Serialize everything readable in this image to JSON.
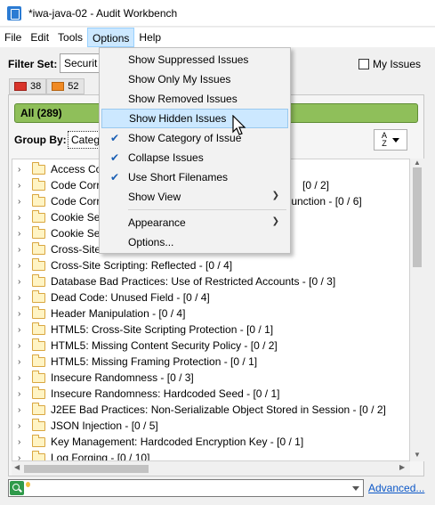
{
  "window": {
    "title": "*iwa-java-02 - Audit Workbench"
  },
  "menubar": {
    "items": [
      "File",
      "Edit",
      "Tools",
      "Options",
      "Help"
    ],
    "active": "Options"
  },
  "filter": {
    "label": "Filter Set:",
    "value": "Securit",
    "my_issues_label": "My Issues"
  },
  "severity_tabs": [
    {
      "count": "38",
      "color": "#d9342b"
    },
    {
      "count": "52",
      "color": "#f08a24"
    }
  ],
  "all_bar": {
    "label": "All (289)"
  },
  "group_by": {
    "label": "Group By:",
    "value": "Categ"
  },
  "sort_icon": {
    "top": "A",
    "bottom": "Z"
  },
  "tree": {
    "rows": [
      "Access Con",
      "Code Corre",
      "Code Corre",
      "Cookie Secu",
      "Cookie Secu",
      "Cross-Site F",
      "Cross-Site Scripting: Reflected - [0 / 4]",
      "Database Bad Practices: Use of Restricted Accounts - [0 / 3]",
      "Dead Code: Unused Field - [0 / 4]",
      "Header Manipulation - [0 / 4]",
      "HTML5: Cross-Site Scripting Protection - [0 / 1]",
      "HTML5: Missing Content Security Policy - [0 / 2]",
      "HTML5: Missing Framing Protection - [0 / 1]",
      "Insecure Randomness - [0 / 3]",
      "Insecure Randomness: Hardcoded Seed - [0 / 1]",
      "J2EE Bad Practices: Non-Serializable Object Stored in Session - [0 / 2]",
      "JSON Injection - [0 / 5]",
      "Key Management: Hardcoded Encryption Key - [0 / 1]",
      "Log Forging - [0 / 10]"
    ],
    "partial_right": [
      {
        "row": 1,
        "text": "[0 / 2]"
      },
      {
        "row": 2,
        "text": "Function - [0 / 6]"
      }
    ]
  },
  "options_menu": {
    "items": [
      {
        "label": "Show Suppressed Issues",
        "checked": false,
        "submenu": false
      },
      {
        "label": "Show Only My Issues",
        "checked": false,
        "submenu": false
      },
      {
        "label": "Show Removed Issues",
        "checked": false,
        "submenu": false
      },
      {
        "label": "Show Hidden Issues",
        "checked": false,
        "submenu": false,
        "hover": true
      },
      {
        "label": "Show Category of Issue",
        "checked": true,
        "submenu": false
      },
      {
        "label": "Collapse Issues",
        "checked": true,
        "submenu": false
      },
      {
        "label": "Use Short Filenames",
        "checked": true,
        "submenu": false
      },
      {
        "label": "Show View",
        "checked": false,
        "submenu": true
      },
      {
        "label": "Appearance",
        "checked": false,
        "submenu": true
      },
      {
        "label": "Options...",
        "checked": false,
        "submenu": false
      }
    ]
  },
  "search": {
    "value": "",
    "advanced_label": "Advanced..."
  },
  "colors": {
    "all_bar": "#8fbf5a",
    "menu_hover": "#cce8ff",
    "link": "#0b57c7"
  }
}
